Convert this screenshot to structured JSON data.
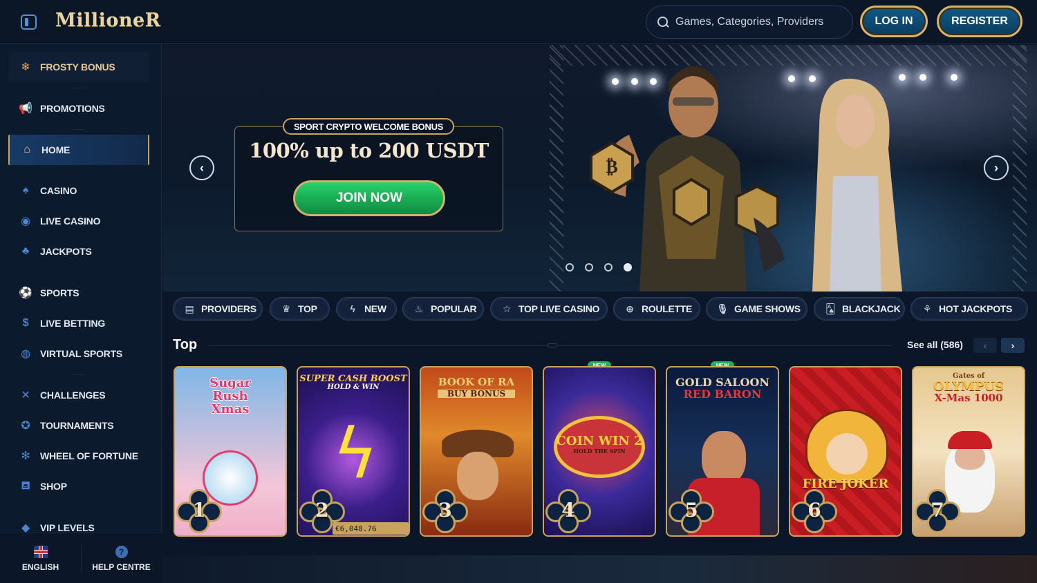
{
  "header": {
    "logo": "MillioneR",
    "search_placeholder": "Games, Categories, Providers",
    "login_label": "LOG IN",
    "register_label": "REGISTER"
  },
  "sidebar": {
    "items": [
      {
        "label": "FROSTY BONUS",
        "icon": "snowflake-icon"
      },
      {
        "label": "PROMOTIONS",
        "icon": "megaphone-icon"
      },
      {
        "label": "HOME",
        "icon": "home-icon"
      },
      {
        "label": "CASINO",
        "icon": "spade-icon"
      },
      {
        "label": "LIVE CASINO",
        "icon": "chip-icon"
      },
      {
        "label": "JACKPOTS",
        "icon": "clover-icon"
      },
      {
        "label": "SPORTS",
        "icon": "soccer-ball-icon"
      },
      {
        "label": "LIVE BETTING",
        "icon": "dollar-coin-icon"
      },
      {
        "label": "VIRTUAL SPORTS",
        "icon": "globe-icon"
      },
      {
        "label": "CHALLENGES",
        "icon": "crossed-swords-icon"
      },
      {
        "label": "TOURNAMENTS",
        "icon": "medal-icon"
      },
      {
        "label": "WHEEL OF FORTUNE",
        "icon": "wheel-icon"
      },
      {
        "label": "SHOP",
        "icon": "basket-icon"
      },
      {
        "label": "VIP LEVELS",
        "icon": "vip-tag-icon"
      }
    ],
    "language": "ENGLISH",
    "help": "HELP CENTRE"
  },
  "hero": {
    "tag": "SPORT CRYPTO WELCOME BONUS",
    "title": "100% up to 200 USDT",
    "cta": "JOIN NOW",
    "slides_total": 4,
    "active_slide": 4
  },
  "categories": [
    {
      "label": "PROVIDERS",
      "icon": "book-icon"
    },
    {
      "label": "TOP",
      "icon": "crown-icon"
    },
    {
      "label": "NEW",
      "icon": "lightning-icon"
    },
    {
      "label": "POPULAR",
      "icon": "flame-icon"
    },
    {
      "label": "TOP LIVE CASINO",
      "icon": "star-icon"
    },
    {
      "label": "ROULETTE",
      "icon": "roulette-icon"
    },
    {
      "label": "GAME SHOWS",
      "icon": "microphone-icon"
    },
    {
      "label": "BLACKJACK",
      "icon": "cards-icon"
    },
    {
      "label": "HOT JACKPOTS",
      "icon": "horn-icon"
    }
  ],
  "top_section": {
    "title": "Top",
    "see_all": "See all (586)",
    "games": [
      {
        "rank": "1",
        "title_line1": "Sugar",
        "title_line2": "Rush",
        "title_line3": "Xmas",
        "new": false
      },
      {
        "rank": "2",
        "title_line1": "SUPER CASH BOOST",
        "title_line2": "HOLD & WIN",
        "jackpot": "€6,048.76",
        "new": false
      },
      {
        "rank": "3",
        "title_line1": "BOOK OF RA",
        "title_line2": "BUY BONUS",
        "new": false
      },
      {
        "rank": "4",
        "title_line1": "COIN WIN 2",
        "title_line2": "HOLD THE SPIN",
        "new": true,
        "new_label": "NEW"
      },
      {
        "rank": "5",
        "title_line1": "GOLD SALOON",
        "title_line2": "RED BARON",
        "new": true,
        "new_label": "NEW"
      },
      {
        "rank": "6",
        "title_line1": "FIRE JOKER",
        "new": false
      },
      {
        "rank": "7",
        "title_line1": "Gates of",
        "title_line2": "OLYMPUS",
        "title_line3": "X-Mas 1000",
        "new": false
      }
    ]
  },
  "colors": {
    "background": "#0b1729",
    "sidebar": "#0c1a2e",
    "gold_accent": "#c9a35c",
    "blue_icon": "#4b86d1",
    "cta_green": "#28d26c"
  }
}
